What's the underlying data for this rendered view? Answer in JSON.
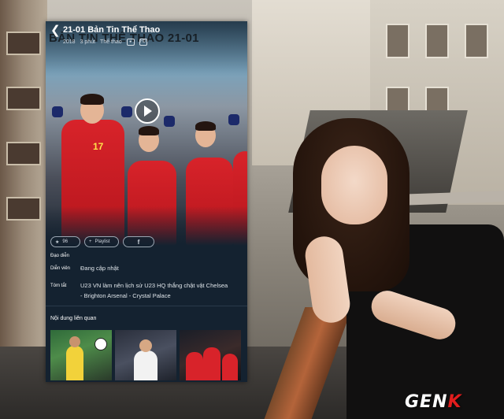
{
  "app": {
    "title": "21-01 Bản Tin Thể Thao",
    "overlay_title": "BẢN TIN THỂ THAO 21-01",
    "meta": {
      "year": "2018",
      "duration": "3 phút",
      "genre": "Thể thao",
      "hd_badge": "HD"
    },
    "hero_number": "17",
    "actions": {
      "like_count": "96",
      "playlist_label": "Playlist",
      "share_label": "f"
    },
    "details": {
      "director_label": "Đạo diễn",
      "cast_label": "Diễn viên",
      "cast_value": "Đang cập nhật",
      "summary_label": "Tóm tắt",
      "summary_line1": "U23 VN làm nên lịch sử    U23 HQ thắng chật vật    Chelsea",
      "summary_line2": "- Brighton    Arsenal - Crystal Palace"
    },
    "related_title": "Nội dung liên quan"
  },
  "brand": {
    "logo_left": "GEN",
    "logo_right": "K"
  },
  "colors": {
    "panel_bg": "#142230",
    "jersey_red": "#d8232a",
    "logo_red": "#e21d1d"
  }
}
